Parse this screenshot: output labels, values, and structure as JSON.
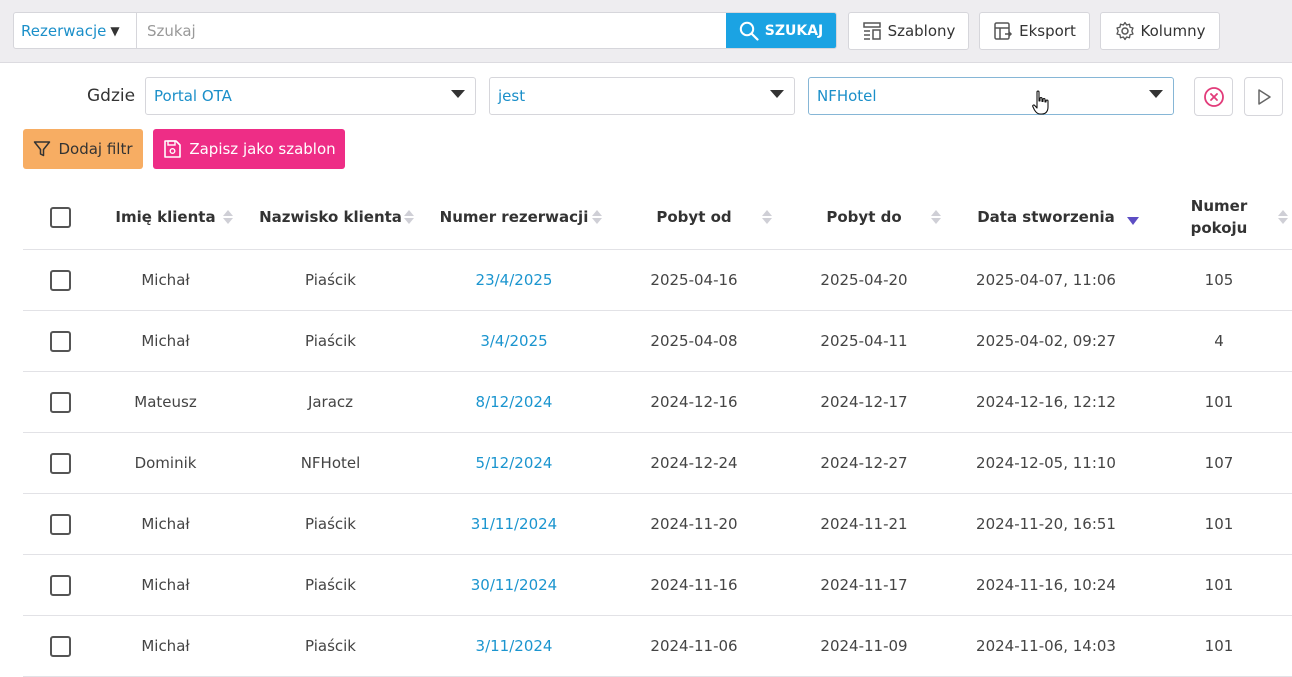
{
  "toolbar": {
    "scope_label": "Rezerwacje",
    "search_placeholder": "Szukaj",
    "search_value": "",
    "search_button": "SZUKAJ",
    "templates_button": "Szablony",
    "export_button": "Eksport",
    "columns_button": "Kolumny"
  },
  "filter": {
    "where_label": "Gdzie",
    "field": "Portal OTA",
    "operator": "jest",
    "value": "NFHotel"
  },
  "actions": {
    "add_filter": "Dodaj filtr",
    "save_template": "Zapisz jako szablon"
  },
  "table": {
    "columns": [
      "Imię klienta",
      "Nazwisko klienta",
      "Numer rezerwacji",
      "Pobyt od",
      "Pobyt do",
      "Data stworzenia",
      "Numer\npokoju"
    ],
    "sorted_column": "Data stworzenia",
    "sort_direction": "descending",
    "rows": [
      [
        "Michał",
        "Piaścik",
        "23/4/2025",
        "2025-04-16",
        "2025-04-20",
        "2025-04-07, 11:06",
        "105"
      ],
      [
        "Michał",
        "Piaścik",
        "3/4/2025",
        "2025-04-08",
        "2025-04-11",
        "2025-04-02, 09:27",
        "4"
      ],
      [
        "Mateusz",
        "Jaracz",
        "8/12/2024",
        "2024-12-16",
        "2024-12-17",
        "2024-12-16, 12:12",
        "101"
      ],
      [
        "Dominik",
        "NFHotel",
        "5/12/2024",
        "2024-12-24",
        "2024-12-27",
        "2024-12-05, 11:10",
        "107"
      ],
      [
        "Michał",
        "Piaścik",
        "31/11/2024",
        "2024-11-20",
        "2024-11-21",
        "2024-11-20, 16:51",
        "101"
      ],
      [
        "Michał",
        "Piaścik",
        "30/11/2024",
        "2024-11-16",
        "2024-11-17",
        "2024-11-16, 10:24",
        "101"
      ],
      [
        "Michał",
        "Piaścik",
        "3/11/2024",
        "2024-11-06",
        "2024-11-09",
        "2024-11-06, 14:03",
        "101"
      ]
    ]
  },
  "colors": {
    "accent": "#1ba3e3",
    "link": "#1b95cf",
    "add_filter_bg": "#f7ad63",
    "save_template_bg": "#ee2d86",
    "clear_icon": "#e23b7a",
    "sort_active": "#5d4ec4"
  },
  "icons": [
    "search-icon",
    "templates-icon",
    "export-icon",
    "gear-icon",
    "clear-filter-icon",
    "play-icon",
    "funnel-icon",
    "save-icon",
    "hand-cursor-icon"
  ]
}
